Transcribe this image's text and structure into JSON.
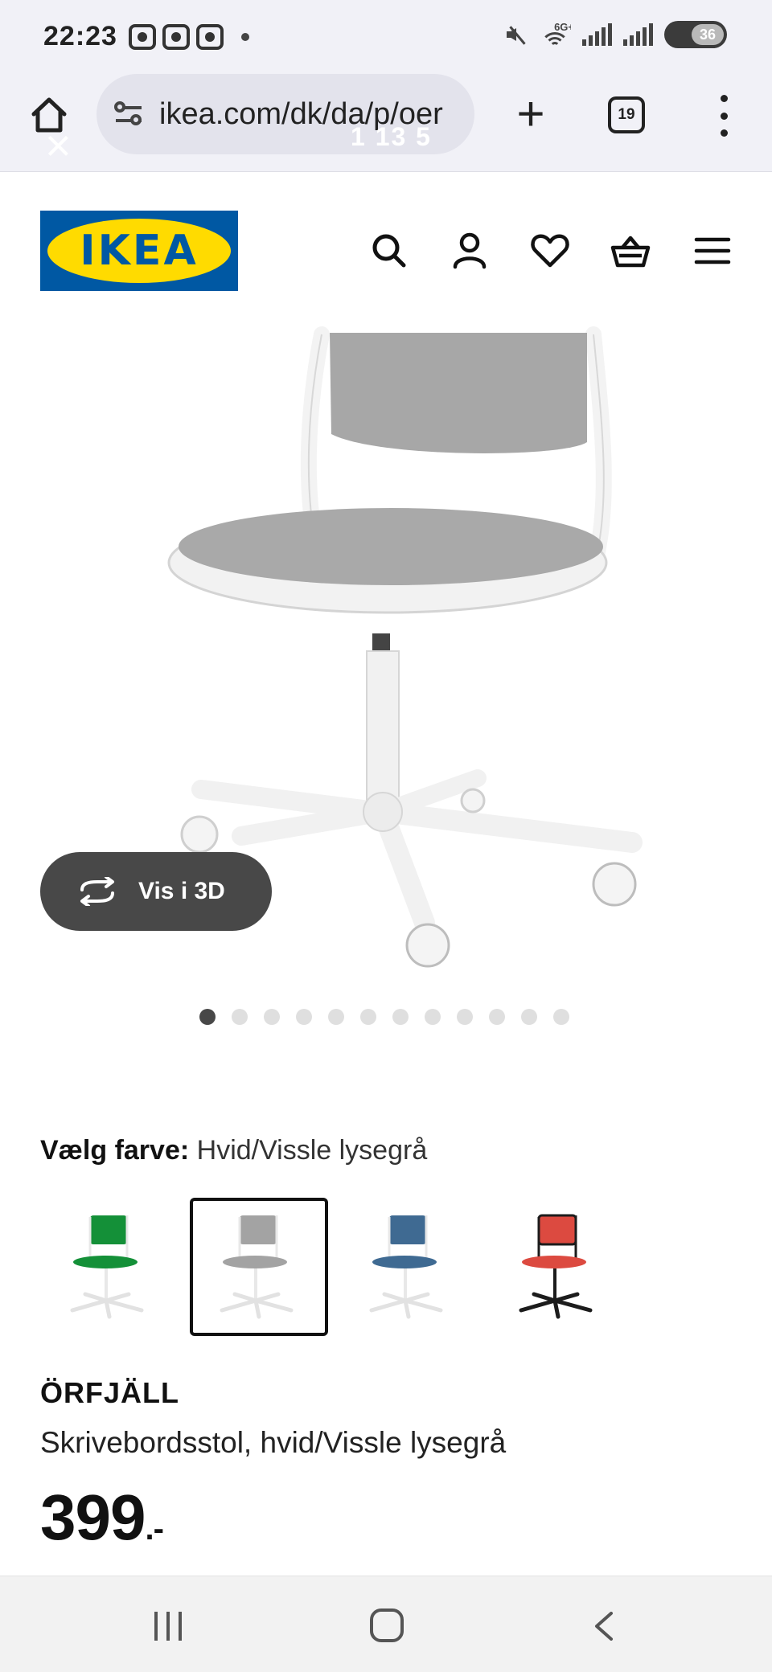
{
  "status_bar": {
    "time": "22:23",
    "network": "6G+",
    "battery": "36"
  },
  "browser": {
    "url": "ikea.com/dk/da/p/oer",
    "tab_count": "19",
    "overlay_close": "×",
    "overlay_numbers": "1 13 5"
  },
  "header": {
    "logo_text": "IKEA",
    "icons": [
      "search-icon",
      "account-icon",
      "heart-icon",
      "basket-icon",
      "menu-icon"
    ]
  },
  "gallery": {
    "view_3d_label": "Vis i 3D",
    "image_count": 12,
    "active_index": 0
  },
  "color_picker": {
    "label": "Vælg farve:",
    "selected_value": "Hvid/Vissle lysegrå",
    "options": [
      {
        "name": "green",
        "seat": "#149038",
        "frame": "#e8e8e8"
      },
      {
        "name": "light-grey",
        "seat": "#a3a3a3",
        "frame": "#e8e8e8"
      },
      {
        "name": "blue",
        "seat": "#3f6a92",
        "frame": "#e8e8e8"
      },
      {
        "name": "red",
        "seat": "#dc4a40",
        "frame": "#1c1c1c"
      }
    ],
    "selected_index": 1
  },
  "product": {
    "name": "ÖRFJÄLL",
    "description": "Skrivebordsstol, hvid/Vissle lysegrå",
    "price": "399",
    "price_suffix": ".-"
  },
  "colors": {
    "ikea_blue": "#0058a3",
    "ikea_yellow": "#ffdb00",
    "chip_dark": "#484848"
  }
}
